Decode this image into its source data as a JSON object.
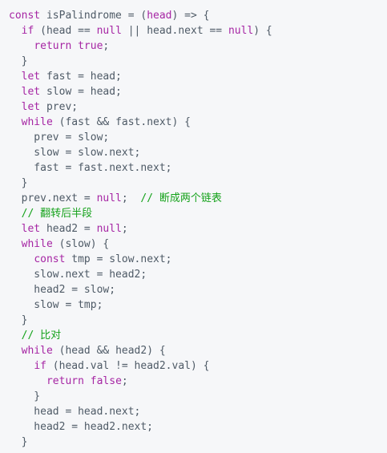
{
  "code": {
    "lines": [
      [
        {
          "t": "const",
          "c": "kw"
        },
        {
          "t": " isPalindrome = (",
          "c": "tx"
        },
        {
          "t": "head",
          "c": "kw"
        },
        {
          "t": ") => {",
          "c": "tx"
        }
      ],
      [
        {
          "t": "  ",
          "c": "tx"
        },
        {
          "t": "if",
          "c": "kw"
        },
        {
          "t": " (head == ",
          "c": "tx"
        },
        {
          "t": "null",
          "c": "kw"
        },
        {
          "t": " || head.next == ",
          "c": "tx"
        },
        {
          "t": "null",
          "c": "kw"
        },
        {
          "t": ") {",
          "c": "tx"
        }
      ],
      [
        {
          "t": "    ",
          "c": "tx"
        },
        {
          "t": "return",
          "c": "kw"
        },
        {
          "t": " ",
          "c": "tx"
        },
        {
          "t": "true",
          "c": "kw"
        },
        {
          "t": ";",
          "c": "tx"
        }
      ],
      [
        {
          "t": "  }",
          "c": "tx"
        }
      ],
      [
        {
          "t": "  ",
          "c": "tx"
        },
        {
          "t": "let",
          "c": "kw"
        },
        {
          "t": " fast = head;",
          "c": "tx"
        }
      ],
      [
        {
          "t": "  ",
          "c": "tx"
        },
        {
          "t": "let",
          "c": "kw"
        },
        {
          "t": " slow = head;",
          "c": "tx"
        }
      ],
      [
        {
          "t": "  ",
          "c": "tx"
        },
        {
          "t": "let",
          "c": "kw"
        },
        {
          "t": " prev;",
          "c": "tx"
        }
      ],
      [
        {
          "t": "  ",
          "c": "tx"
        },
        {
          "t": "while",
          "c": "kw"
        },
        {
          "t": " (fast && fast.next) {",
          "c": "tx"
        }
      ],
      [
        {
          "t": "    prev = slow;",
          "c": "tx"
        }
      ],
      [
        {
          "t": "    slow = slow.next;",
          "c": "tx"
        }
      ],
      [
        {
          "t": "    fast = fast.next.next;",
          "c": "tx"
        }
      ],
      [
        {
          "t": "  }",
          "c": "tx"
        }
      ],
      [
        {
          "t": "  prev.next = ",
          "c": "tx"
        },
        {
          "t": "null",
          "c": "kw"
        },
        {
          "t": ";  ",
          "c": "tx"
        },
        {
          "t": "// 断成两个链表",
          "c": "cm"
        }
      ],
      [
        {
          "t": "  ",
          "c": "tx"
        },
        {
          "t": "// 翻转后半段",
          "c": "cm"
        }
      ],
      [
        {
          "t": "  ",
          "c": "tx"
        },
        {
          "t": "let",
          "c": "kw"
        },
        {
          "t": " head2 = ",
          "c": "tx"
        },
        {
          "t": "null",
          "c": "kw"
        },
        {
          "t": ";",
          "c": "tx"
        }
      ],
      [
        {
          "t": "  ",
          "c": "tx"
        },
        {
          "t": "while",
          "c": "kw"
        },
        {
          "t": " (slow) {",
          "c": "tx"
        }
      ],
      [
        {
          "t": "    ",
          "c": "tx"
        },
        {
          "t": "const",
          "c": "kw"
        },
        {
          "t": " tmp = slow.next;",
          "c": "tx"
        }
      ],
      [
        {
          "t": "    slow.next = head2;",
          "c": "tx"
        }
      ],
      [
        {
          "t": "    head2 = slow;",
          "c": "tx"
        }
      ],
      [
        {
          "t": "    slow = tmp;",
          "c": "tx"
        }
      ],
      [
        {
          "t": "  }",
          "c": "tx"
        }
      ],
      [
        {
          "t": "  ",
          "c": "tx"
        },
        {
          "t": "// 比对",
          "c": "cm"
        }
      ],
      [
        {
          "t": "  ",
          "c": "tx"
        },
        {
          "t": "while",
          "c": "kw"
        },
        {
          "t": " (head && head2) {",
          "c": "tx"
        }
      ],
      [
        {
          "t": "    ",
          "c": "tx"
        },
        {
          "t": "if",
          "c": "kw"
        },
        {
          "t": " (head.val != head2.val) {",
          "c": "tx"
        }
      ],
      [
        {
          "t": "      ",
          "c": "tx"
        },
        {
          "t": "return",
          "c": "kw"
        },
        {
          "t": " ",
          "c": "tx"
        },
        {
          "t": "false",
          "c": "kw"
        },
        {
          "t": ";",
          "c": "tx"
        }
      ],
      [
        {
          "t": "    }",
          "c": "tx"
        }
      ],
      [
        {
          "t": "    head = head.next;",
          "c": "tx"
        }
      ],
      [
        {
          "t": "    head2 = head2.next;",
          "c": "tx"
        }
      ],
      [
        {
          "t": "  }",
          "c": "tx"
        }
      ]
    ]
  },
  "colors": {
    "background": "#f6f7f9",
    "keyword": "#a626a4",
    "comment": "#15a21b",
    "text": "#4e5a66"
  }
}
